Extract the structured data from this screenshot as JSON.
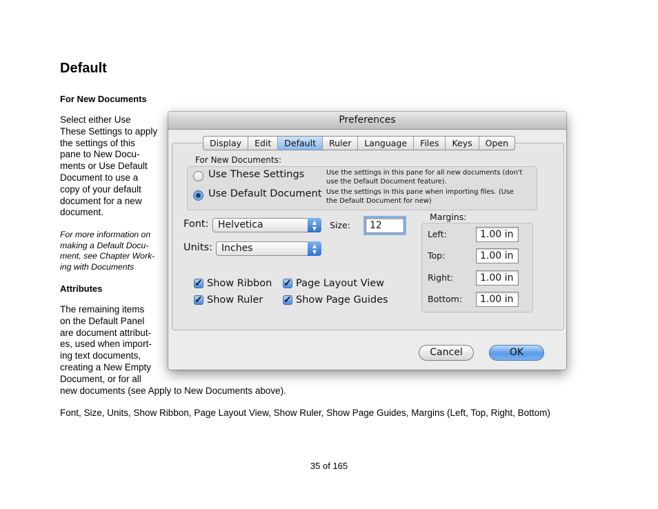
{
  "page": {
    "title": "Default",
    "section1_heading": "For New Documents",
    "para1_lines": [
      "Select either Use",
      "These Settings to apply",
      "the settings of this",
      "pane to New Docu-",
      "ments or Use Default",
      "Document to use a",
      "copy of your default",
      "document for a new",
      "document."
    ],
    "note_lines": [
      "For more information on",
      "making a Default Docu-",
      "ment, see Chapter Work-",
      "ing with Documents"
    ],
    "section2_heading": "Attributes",
    "para2_lines": [
      "The remaining items",
      "on the Default Panel",
      "are document attribut-",
      "es, used when import-",
      "ing text documents,",
      "creating a New Empty",
      "Document, or for all",
      "new documents (see Apply to New Documents above)."
    ],
    "attributes_list": "Font, Size, Units, Show Ribbon, Page Layout View, Show Ruler,  Show Page Guides, Margins (Left, Top, Right, Bottom)",
    "page_number": "35 of 165"
  },
  "dialog": {
    "title": "Preferences",
    "tabs": [
      "Display",
      "Edit",
      "Default",
      "Ruler",
      "Language",
      "Files",
      "Keys",
      "Open"
    ],
    "selected_tab": "Default",
    "for_new_documents_label": "For New Documents:",
    "radio_use_settings": {
      "label": "Use These Settings",
      "selected": false,
      "desc_lines": [
        "Use the settings in this pane for all new documents (don't",
        "use the Default Document feature)."
      ]
    },
    "radio_use_default": {
      "label": "Use Default Document",
      "selected": true,
      "desc_lines": [
        "Use the settings in this pane when importing files. (Use",
        "the Default Document for new)"
      ]
    },
    "font_label": "Font:",
    "font_value": "Helvetica",
    "size_label": "Size:",
    "size_value": "12",
    "units_label": "Units:",
    "units_value": "Inches",
    "margins_label": "Margins:",
    "margins": [
      {
        "label": "Left:",
        "value": "1.00 in"
      },
      {
        "label": "Top:",
        "value": "1.00 in"
      },
      {
        "label": "Right:",
        "value": "1.00 in"
      },
      {
        "label": "Bottom:",
        "value": "1.00 in"
      }
    ],
    "checkboxes": {
      "show_ribbon": {
        "label": "Show Ribbon",
        "checked": true
      },
      "page_layout_view": {
        "label": "Page Layout View",
        "checked": true
      },
      "show_ruler": {
        "label": "Show Ruler",
        "checked": true
      },
      "show_page_guides": {
        "label": "Show Page Guides",
        "checked": true
      }
    },
    "cancel_label": "Cancel",
    "ok_label": "OK",
    "accent_color": "#5a9ae6"
  }
}
